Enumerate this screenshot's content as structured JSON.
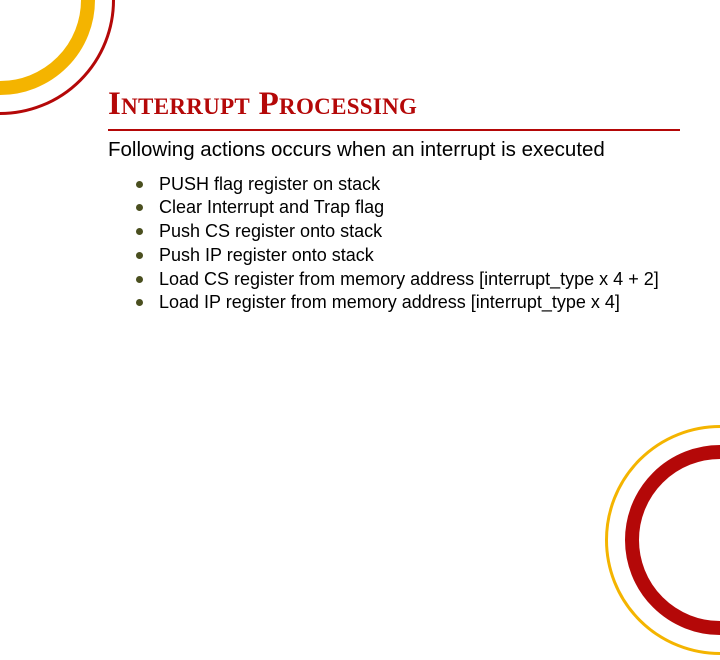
{
  "title": "Interrupt Processing",
  "subtitle": "Following actions occurs when an interrupt is executed",
  "bullets": [
    "PUSH flag register on stack",
    "Clear Interrupt and Trap flag",
    "Push CS register onto stack",
    "Push IP register onto stack",
    "Load CS register from memory address [interrupt_type x 4 + 2]",
    "Load IP register from memory address [interrupt_type x 4]"
  ],
  "colors": {
    "title": "#b40808",
    "accent_yellow": "#f4b400",
    "bullet_dot": "#4a4f1f"
  }
}
